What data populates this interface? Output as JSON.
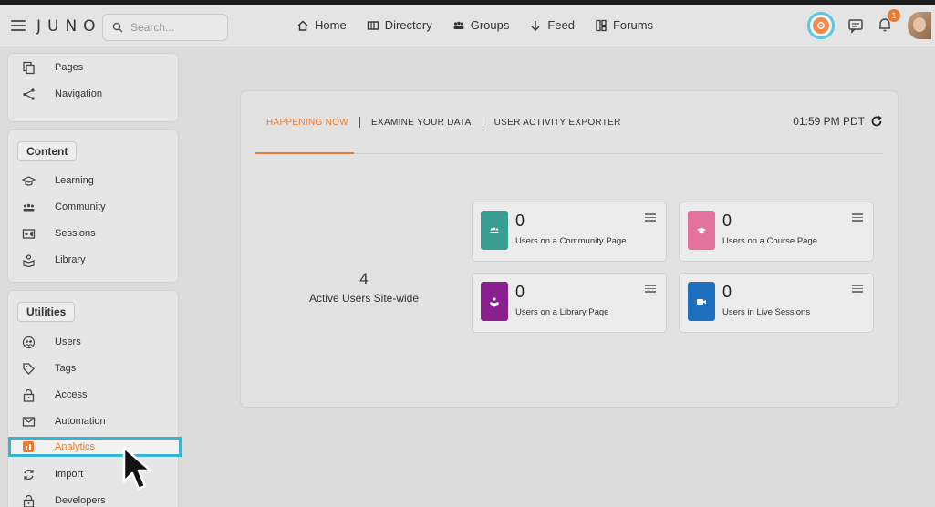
{
  "header": {
    "logo": "JUNO",
    "search_placeholder": "Search...",
    "nav": [
      {
        "label": "Home",
        "icon": "home-icon"
      },
      {
        "label": "Directory",
        "icon": "directory-icon"
      },
      {
        "label": "Groups",
        "icon": "groups-icon"
      },
      {
        "label": "Feed",
        "icon": "arrow-down-icon"
      },
      {
        "label": "Forums",
        "icon": "forums-icon"
      }
    ],
    "notification_count": "1"
  },
  "sidebar": {
    "top_items": [
      {
        "label": "Pages",
        "icon": "pages-icon"
      },
      {
        "label": "Navigation",
        "icon": "share-icon"
      }
    ],
    "content": {
      "title": "Content",
      "items": [
        {
          "label": "Learning",
          "icon": "graduation-cap-icon"
        },
        {
          "label": "Community",
          "icon": "community-icon"
        },
        {
          "label": "Sessions",
          "icon": "sessions-icon"
        },
        {
          "label": "Library",
          "icon": "library-icon"
        }
      ]
    },
    "utilities": {
      "title": "Utilities",
      "items": [
        {
          "label": "Users",
          "icon": "users-icon"
        },
        {
          "label": "Tags",
          "icon": "tag-icon"
        },
        {
          "label": "Access",
          "icon": "lock-icon"
        },
        {
          "label": "Automation",
          "icon": "mail-icon"
        },
        {
          "label": "Analytics",
          "icon": "analytics-icon",
          "active": true
        },
        {
          "label": "Import",
          "icon": "import-icon"
        },
        {
          "label": "Developers",
          "icon": "lock-icon"
        }
      ]
    }
  },
  "main": {
    "tabs": [
      {
        "label": "HAPPENING NOW",
        "active": true
      },
      {
        "label": "EXAMINE YOUR DATA"
      },
      {
        "label": "USER ACTIVITY EXPORTER"
      }
    ],
    "time": "01:59 PM PDT",
    "active_users": {
      "value": "4",
      "label": "Active Users Site-wide"
    },
    "stats": [
      {
        "value": "0",
        "label": "Users on a Community Page",
        "color": "#3a9e94",
        "icon": "community-icon"
      },
      {
        "value": "0",
        "label": "Users on a Course Page",
        "color": "#e3739c",
        "icon": "graduation-cap-icon"
      },
      {
        "value": "0",
        "label": "Users on a Library Page",
        "color": "#8a1f8f",
        "icon": "library-icon"
      },
      {
        "value": "0",
        "label": "Users in Live Sessions",
        "color": "#1f6fbf",
        "icon": "video-icon"
      }
    ]
  },
  "colors": {
    "accent": "#ef7a2f",
    "highlight": "#35b5d1"
  }
}
